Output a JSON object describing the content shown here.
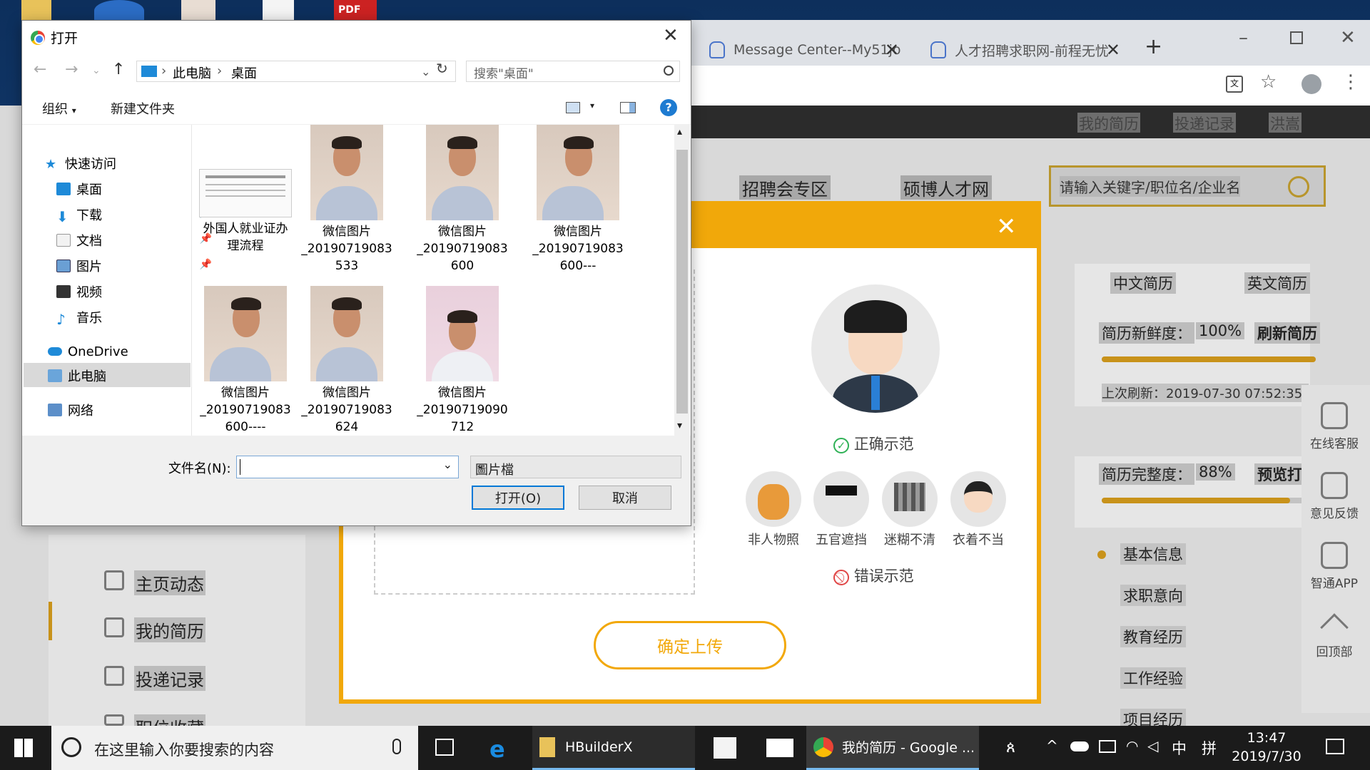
{
  "browser": {
    "tabs": [
      {
        "label": "Message Center--My51jo"
      },
      {
        "label": "人才招聘求职网-前程无忧"
      }
    ]
  },
  "site": {
    "topnav": [
      "我的简历",
      "投递记录",
      "洪嵩"
    ],
    "nav": [
      "招聘会专区",
      "硕博人才网"
    ],
    "search_placeholder": "请输入关键字/职位名/企业名",
    "resume_tabs": [
      "中文简历",
      "英文简历"
    ],
    "freshness_label": "简历新鲜度：",
    "freshness_value": "100%",
    "refresh_button": "刷新简历",
    "last_refresh": "上次刷新：2019-07-30   07:52:35",
    "completeness_label": "简历完整度：",
    "completeness_value": "88%",
    "preview_button": "预览打",
    "freshness_fraction": 1.0,
    "completeness_fraction": 0.88,
    "left_menu": [
      "主页动态",
      "我的简历",
      "投递记录",
      "职位收藏"
    ],
    "right_menu": [
      "基本信息",
      "求职意向",
      "教育经历",
      "工作经验",
      "项目经历"
    ],
    "right_tools": [
      "在线客服",
      "意见反馈",
      "智通APP",
      "回顶部"
    ]
  },
  "modal": {
    "correct_label": "正确示范",
    "wrong_label": "错误示范",
    "samples": [
      "非人物照",
      "五官遮挡",
      "迷糊不清",
      "衣着不当"
    ],
    "confirm_button": "确定上传",
    "close_glyph": "✕"
  },
  "dialog": {
    "title": "打开",
    "breadcrumb": [
      "此电脑",
      "桌面"
    ],
    "search_placeholder": "搜索\"桌面\"",
    "toolbar": {
      "organize": "组织",
      "new_folder": "新建文件夹",
      "help": "?"
    },
    "nav_tree": [
      {
        "label": "快速访问",
        "pinned": false
      },
      {
        "label": "桌面",
        "pinned": true
      },
      {
        "label": "下载",
        "pinned": true
      },
      {
        "label": "文档",
        "pinned": true
      },
      {
        "label": "图片",
        "pinned": true
      },
      {
        "label": "视频",
        "pinned": false
      },
      {
        "label": "音乐",
        "pinned": false
      },
      {
        "label": "OneDrive",
        "pinned": false
      },
      {
        "label": "此电脑",
        "pinned": false
      },
      {
        "label": "网络",
        "pinned": false
      }
    ],
    "files": [
      {
        "line1": "外国人就业证办",
        "line2": "理流程",
        "line3": ""
      },
      {
        "line1": "微信图片",
        "line2": "_20190719083",
        "line3": "533"
      },
      {
        "line1": "微信图片",
        "line2": "_20190719083",
        "line3": "600"
      },
      {
        "line1": "微信图片",
        "line2": "_20190719083",
        "line3": "600---"
      },
      {
        "line1": "微信图片",
        "line2": "_20190719083",
        "line3": "600----"
      },
      {
        "line1": "微信图片",
        "line2": "_20190719083",
        "line3": "624"
      },
      {
        "line1": "微信图片",
        "line2": "_20190719090",
        "line3": "712"
      }
    ],
    "filename_label": "文件名(N):",
    "filename_value": "",
    "filetype_value": "圖片檔",
    "open_button": "打开(O)",
    "cancel_button": "取消"
  },
  "taskbar": {
    "search_placeholder": "在这里输入你要搜索的内容",
    "apps": [
      "HBuilderX",
      "我的简历 - Google ..."
    ],
    "ime_lang": "中",
    "ime_mode": "拼",
    "time": "13:47",
    "date": "2019/7/30"
  }
}
